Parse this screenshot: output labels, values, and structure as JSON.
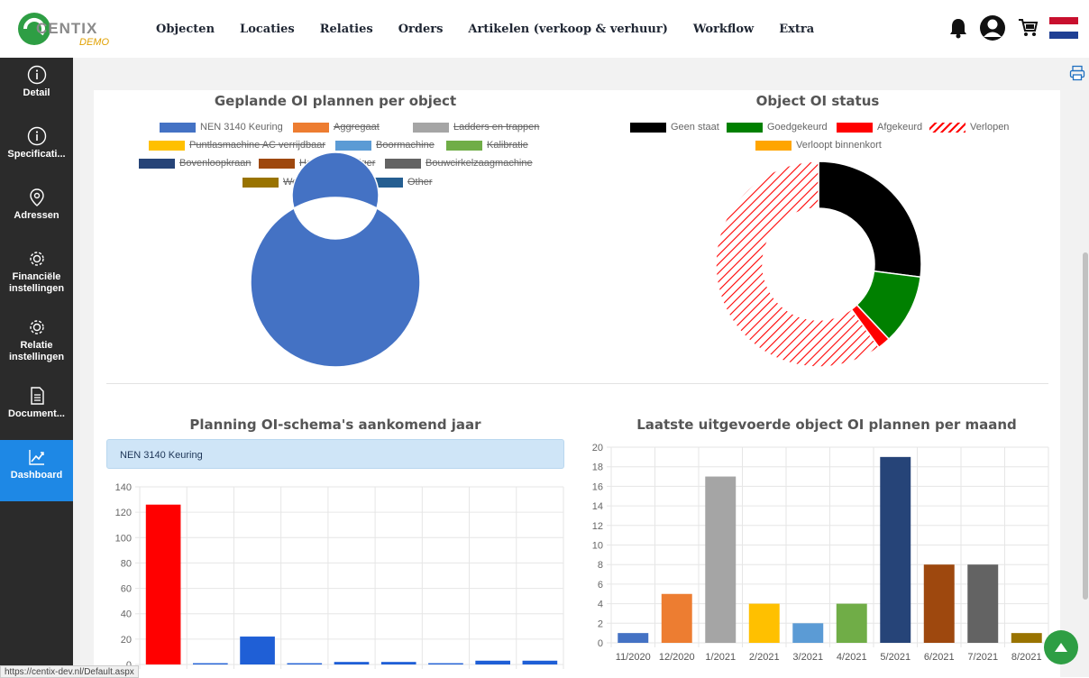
{
  "brand": {
    "name": "CENTIX",
    "sub": "DEMO"
  },
  "nav": [
    {
      "label": "Objecten"
    },
    {
      "label": "Locaties"
    },
    {
      "label": "Relaties"
    },
    {
      "label": "Orders"
    },
    {
      "label": "Artikelen (verkoop & verhuur)"
    },
    {
      "label": "Workflow"
    },
    {
      "label": "Extra"
    }
  ],
  "sidebar": [
    {
      "label": "Detail",
      "icon": "info-icon"
    },
    {
      "label": "Specificati...",
      "icon": "info-icon"
    },
    {
      "label": "Adressen",
      "icon": "location-pin-icon"
    },
    {
      "label": "Financiële instellingen",
      "icon": "gear-icon"
    },
    {
      "label": "Relatie instellingen",
      "icon": "gear-icon"
    },
    {
      "label": "Document...",
      "icon": "document-icon"
    },
    {
      "label": "Dashboard",
      "icon": "chart-line-icon",
      "active": true
    }
  ],
  "status_url": "https://centix-dev.nl/Default.aspx",
  "series_selector": "NEN 3140 Keuring",
  "colors": {
    "accent": "#1e88e5",
    "sidebar": "#2b2b2b",
    "scroll_up": "#2e9e44"
  },
  "chart_data": [
    {
      "type": "pie",
      "title": "Geplande OI plannen per object",
      "legend": [
        {
          "label": "NEN 3140 Keuring",
          "color": "#4472c4",
          "hidden": false
        },
        {
          "label": "Aggregaat",
          "color": "#ed7d31",
          "hidden": true
        },
        {
          "label": "Ladders en trappen",
          "color": "#a5a5a5",
          "hidden": true
        },
        {
          "label": "Puntlasmachine AC verrijdbaar",
          "color": "#ffc000",
          "hidden": true
        },
        {
          "label": "Boormachine",
          "color": "#5b9bd5",
          "hidden": true
        },
        {
          "label": "Kalibratie",
          "color": "#70ad47",
          "hidden": true
        },
        {
          "label": "Bovenloopkraan",
          "color": "#264478",
          "hidden": true
        },
        {
          "label": "Hogedrukreiniger",
          "color": "#9e480e",
          "hidden": true
        },
        {
          "label": "Bouwcirkelzaagmachine",
          "color": "#636363",
          "hidden": true
        },
        {
          "label": "Werkplaatskraan",
          "color": "#997300",
          "hidden": true
        },
        {
          "label": "Other",
          "color": "#255e91",
          "hidden": true
        }
      ],
      "slices": [
        {
          "label": "NEN 3140 Keuring",
          "value": 100
        }
      ]
    },
    {
      "type": "pie",
      "title": "Object OI status",
      "legend": [
        {
          "label": "Geen staat",
          "color": "#000000"
        },
        {
          "label": "Goedgekeurd",
          "color": "#008000"
        },
        {
          "label": "Afgekeurd",
          "color": "#ff0000"
        },
        {
          "label": "Verlopen",
          "color": "#ff0000",
          "pattern": "hatched"
        },
        {
          "label": "Verloopt binnenkort",
          "color": "#ffa500"
        }
      ],
      "slices": [
        {
          "label": "Geen staat",
          "value": 27
        },
        {
          "label": "Goedgekeurd",
          "value": 11
        },
        {
          "label": "Afgekeurd",
          "value": 2
        },
        {
          "label": "Verlopen",
          "value": 60
        }
      ]
    },
    {
      "type": "bar",
      "title": "Planning OI-schema's aankomend jaar",
      "ylim": [
        0,
        140
      ],
      "yticks": [
        0,
        20,
        40,
        60,
        80,
        100,
        120,
        140
      ],
      "values": [
        126,
        1,
        22,
        1,
        2,
        2,
        1,
        3,
        3
      ],
      "colors": [
        "#ff0000",
        "#1f5fd6",
        "#1f5fd6",
        "#1f5fd6",
        "#1f5fd6",
        "#1f5fd6",
        "#1f5fd6",
        "#1f5fd6",
        "#1f5fd6"
      ]
    },
    {
      "type": "bar",
      "title": "Laatste uitgevoerde object OI plannen per maand",
      "ylim": [
        0,
        20
      ],
      "yticks": [
        0,
        2,
        4,
        6,
        8,
        10,
        12,
        14,
        16,
        18,
        20
      ],
      "categories": [
        "11/2020",
        "12/2020",
        "1/2021",
        "2/2021",
        "3/2021",
        "4/2021",
        "5/2021",
        "6/2021",
        "7/2021",
        "8/2021"
      ],
      "values": [
        1,
        5,
        17,
        4,
        2,
        4,
        19,
        8,
        8,
        1
      ],
      "colors": [
        "#4472c4",
        "#ed7d31",
        "#a5a5a5",
        "#ffc000",
        "#5b9bd5",
        "#70ad47",
        "#264478",
        "#9e480e",
        "#636363",
        "#997300"
      ]
    }
  ]
}
